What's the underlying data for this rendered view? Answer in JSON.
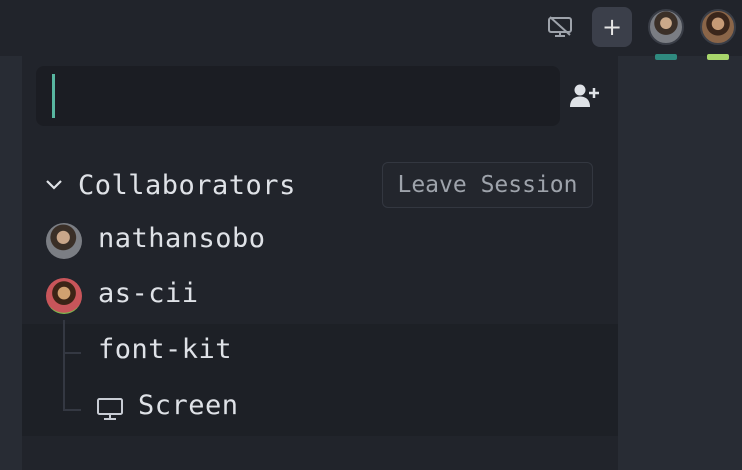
{
  "titlebar": {
    "screen_share_icon": "screen-off-icon",
    "add_icon": "+",
    "avatars": [
      "nathansobo-avatar",
      "as-cii-avatar"
    ]
  },
  "panel": {
    "search": {
      "value": "",
      "placeholder": ""
    },
    "invite_icon": "user-plus-icon",
    "section": {
      "title": "Collaborators",
      "expanded": true,
      "leave_label": "Leave Session"
    },
    "collaborators": [
      {
        "name": "nathansobo"
      },
      {
        "name": "as-cii",
        "children": [
          {
            "label": "font-kit"
          },
          {
            "label": "Screen",
            "icon": "monitor-icon"
          }
        ]
      }
    ]
  },
  "colors": {
    "background": "#282c34",
    "panel": "#21242b",
    "caret": "#58b6a0",
    "presence_teal": "#2f8a7f",
    "presence_green": "#a8d66b"
  }
}
